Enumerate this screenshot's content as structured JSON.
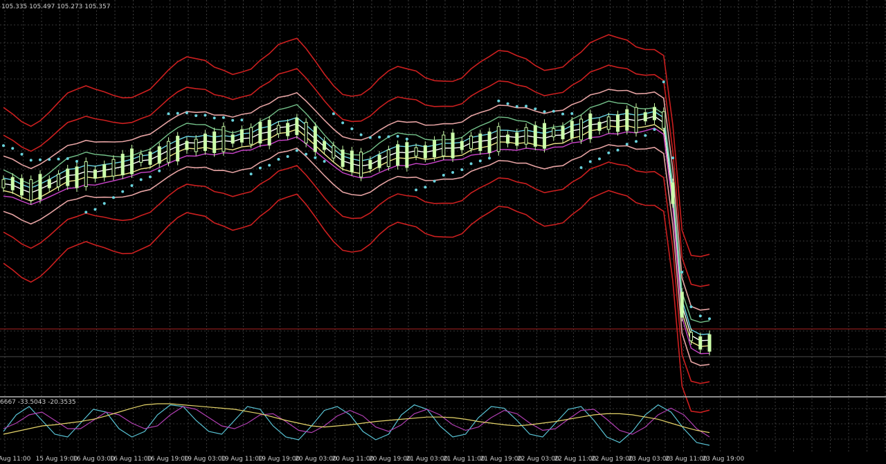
{
  "header": {
    "ohlc_text": "105.335 105.497 105.273 105.357"
  },
  "indicator": {
    "values_text": "6667 -33.5043 -20.3535"
  },
  "colors": {
    "background": "#000000",
    "grid": "#4a4a4a",
    "candle": "#ccffaa",
    "bollinger": "#cc1f1f",
    "envelope": "#e6a3a3",
    "ma_white": "#ffffff",
    "ma_yellow": "#f2e88a",
    "ma_magenta": "#cc44cc",
    "ma_cyan": "#6ad6e6",
    "ma_green": "#74c18a",
    "sar": "#68d2dc",
    "osc_yellow": "#e6d56a",
    "osc_magenta": "#b23fb3",
    "osc_cyan": "#59c4d6",
    "level_line": "#8a1c1c"
  },
  "chart_data": {
    "type": "line",
    "symbol_price_last": 105.357,
    "x_tick_labels": [
      "Aug 11:00",
      "15 Aug 19:00",
      "16 Aug 03:00",
      "16 Aug 11:00",
      "16 Aug 19:00",
      "19 Aug 03:00",
      "19 Aug 11:00",
      "19 Aug 19:00",
      "20 Aug 03:00",
      "20 Aug 11:00",
      "20 Aug 19:00",
      "21 Aug 03:00",
      "21 Aug 11:00",
      "21 Aug 19:00",
      "22 Aug 03:00",
      "22 Aug 11:00",
      "22 Aug 19:00",
      "23 Aug 03:00",
      "23 Aug 11:00",
      "23 Aug 19:00"
    ],
    "main_close_series": [
      58,
      58,
      57,
      56,
      57,
      58,
      59,
      60,
      60,
      61,
      61,
      62,
      63,
      64,
      65,
      66,
      66,
      67,
      68,
      69,
      70,
      70,
      71,
      71,
      72,
      72,
      73,
      73,
      74,
      74,
      75,
      75,
      76,
      74,
      72,
      70,
      68,
      66,
      65,
      64,
      64,
      65,
      66,
      67,
      67,
      68,
      68,
      69,
      70,
      70,
      70,
      71,
      71,
      71,
      72,
      72,
      72,
      73,
      73,
      73,
      74,
      74,
      75,
      75,
      76,
      76,
      77,
      77,
      78,
      78,
      79,
      80,
      78,
      55,
      20,
      10,
      8,
      8
    ],
    "oscillator_series": [
      {
        "color_key": "osc_cyan",
        "values": [
          40,
          70,
          85,
          60,
          35,
          30,
          55,
          80,
          75,
          45,
          30,
          40,
          70,
          88,
          85,
          60,
          40,
          35,
          60,
          85,
          80,
          50,
          30,
          25,
          50,
          78,
          85,
          70,
          40,
          25,
          35,
          70,
          88,
          80,
          50,
          30,
          35,
          65,
          85,
          82,
          60,
          35,
          30,
          55,
          80,
          85,
          60,
          30,
          20,
          40,
          70,
          88,
          75,
          45,
          20,
          15
        ]
      },
      {
        "color_key": "osc_magenta",
        "values": [
          45,
          55,
          70,
          75,
          60,
          45,
          45,
          60,
          75,
          70,
          55,
          45,
          50,
          70,
          85,
          80,
          65,
          50,
          45,
          55,
          70,
          72,
          58,
          42,
          38,
          50,
          68,
          78,
          68,
          48,
          40,
          52,
          72,
          80,
          70,
          52,
          42,
          48,
          65,
          78,
          72,
          55,
          42,
          45,
          62,
          78,
          80,
          62,
          42,
          35,
          48,
          70,
          82,
          70,
          45,
          30
        ]
      },
      {
        "color_key": "osc_yellow",
        "values": [
          35,
          40,
          45,
          50,
          52,
          55,
          58,
          62,
          68,
          75,
          82,
          88,
          90,
          90,
          88,
          86,
          84,
          82,
          80,
          76,
          72,
          66,
          60,
          55,
          50,
          48,
          50,
          52,
          55,
          58,
          60,
          62,
          64,
          66,
          66,
          65,
          62,
          58,
          55,
          52,
          50,
          52,
          55,
          58,
          62,
          66,
          70,
          72,
          72,
          70,
          66,
          62,
          55,
          48,
          42,
          38
        ]
      }
    ],
    "oscillator_range": [
      0,
      100
    ],
    "grid": true,
    "main_panel_height_ratio": 0.855
  }
}
